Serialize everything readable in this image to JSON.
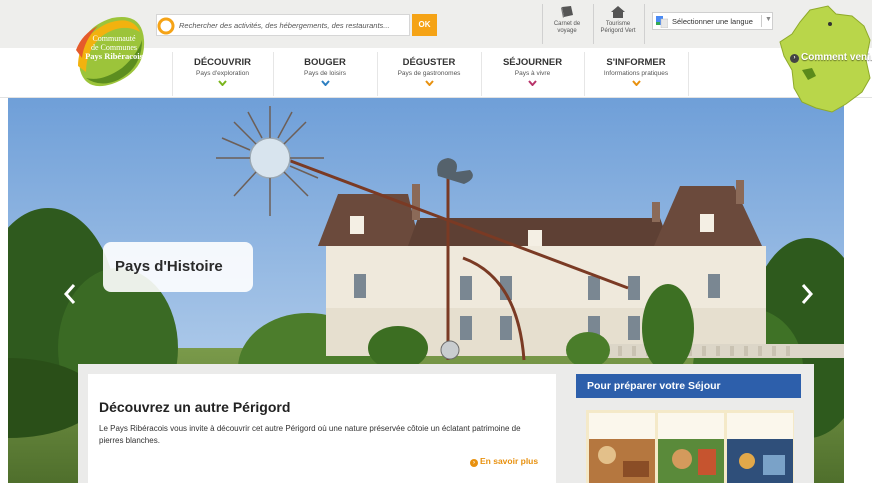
{
  "brand": {
    "logo_line1": "Communauté",
    "logo_line2": "de Communes",
    "logo_line3": "Pays Ribéracois"
  },
  "search": {
    "placeholder": "Rechercher des activités, des hébergements, des restaurants...",
    "button_label": "OK"
  },
  "top_links": [
    {
      "line1": "Carnet de",
      "line2": "voyage",
      "icon": "book-icon"
    },
    {
      "line1": "Tourisme",
      "line2": "Périgord Vert",
      "icon": "house-icon"
    }
  ],
  "language": {
    "label": "Sélectionner une langue",
    "arrow": "▼"
  },
  "map": {
    "label": "Comment venir"
  },
  "nav": [
    {
      "title": "DÉCOUVRIR",
      "subtitle": "Pays d'exploration",
      "chevron_color": "#7ab51d"
    },
    {
      "title": "BOUGER",
      "subtitle": "Pays de loisirs",
      "chevron_color": "#2d7fc1"
    },
    {
      "title": "DÉGUSTER",
      "subtitle": "Pays de gastronomes",
      "chevron_color": "#e8910f"
    },
    {
      "title": "SÉJOURNER",
      "subtitle": "Pays à vivre",
      "chevron_color": "#b8346a"
    },
    {
      "title": "S'INFORMER",
      "subtitle": "Informations pratiques",
      "chevron_color": "#e8910f"
    }
  ],
  "hero": {
    "caption": "Pays d'Histoire",
    "prev_label": "‹",
    "next_label": "›"
  },
  "article": {
    "title": "Découvrez un autre Périgord",
    "body": "Le Pays Ribéracois vous invite à découvrir cet autre Périgord où une nature préservée côtoie un éclatant patrimoine de pierres blanches.",
    "more_label": "En savoir plus"
  },
  "sidebar": {
    "heading": "Pour préparer votre Séjour"
  },
  "colors": {
    "accent_orange": "#f5a316",
    "brand_blue": "#2d5fab",
    "topbar_bg": "#eeeeec"
  }
}
